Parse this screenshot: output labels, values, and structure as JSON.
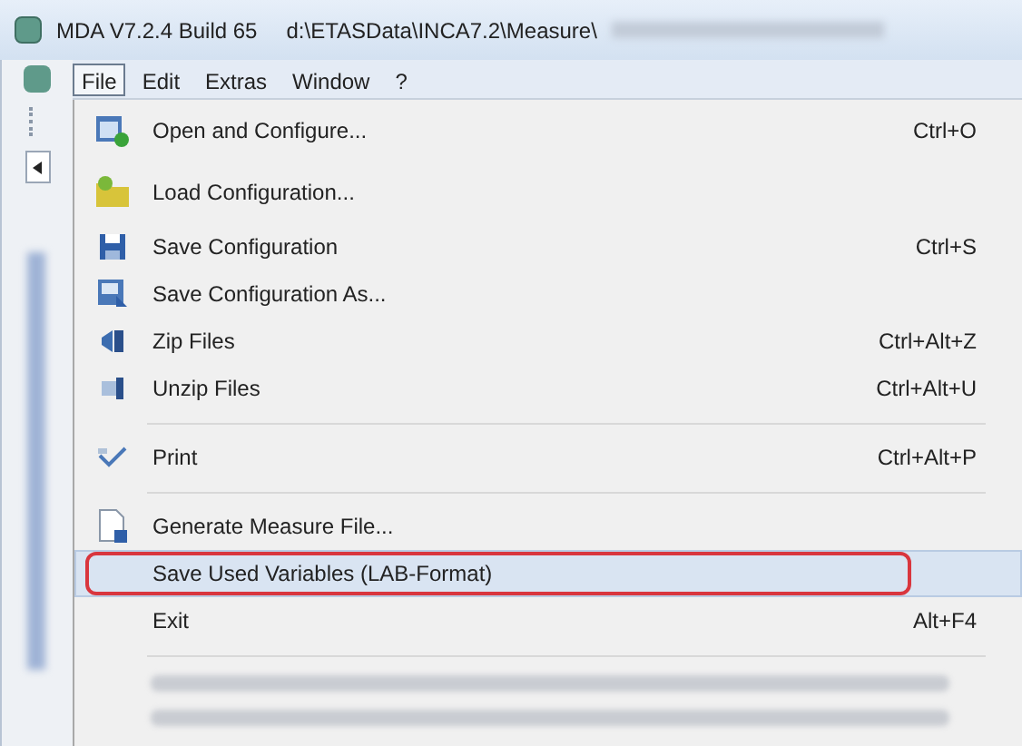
{
  "window": {
    "title": "MDA V7.2.4 Build 65",
    "path": "d:\\ETASData\\INCA7.2\\Measure\\"
  },
  "menubar": [
    {
      "label": "File",
      "selected": true
    },
    {
      "label": "Edit",
      "selected": false
    },
    {
      "label": "Extras",
      "selected": false
    },
    {
      "label": "Window",
      "selected": false
    },
    {
      "label": "?",
      "selected": false
    }
  ],
  "menu": [
    {
      "kind": "item",
      "label": "Open and Configure...",
      "shortcut": "Ctrl+O",
      "selected": false,
      "annotated": false
    },
    {
      "kind": "item",
      "label": "Load Configuration...",
      "selected": false,
      "annotated": false
    },
    {
      "kind": "item",
      "label": "Save Configuration",
      "shortcut": "Ctrl+S",
      "selected": false,
      "annotated": false
    },
    {
      "kind": "item",
      "label": "Save Configuration As...",
      "selected": false,
      "annotated": false
    },
    {
      "kind": "item",
      "label": "Zip Files",
      "shortcut": "Ctrl+Alt+Z",
      "selected": false,
      "annotated": false
    },
    {
      "kind": "item",
      "label": "Unzip Files",
      "shortcut": "Ctrl+Alt+U",
      "selected": false,
      "annotated": false
    },
    {
      "kind": "separator"
    },
    {
      "kind": "item",
      "label": "Print",
      "shortcut": "Ctrl+Alt+P",
      "selected": false,
      "annotated": false
    },
    {
      "kind": "separator"
    },
    {
      "kind": "item",
      "label": "Generate Measure File...",
      "selected": false,
      "annotated": false
    },
    {
      "kind": "item",
      "label": "Save Used Variables (LAB-Format)",
      "selected": true,
      "annotated": true
    },
    {
      "kind": "item",
      "label": "Exit",
      "shortcut": "Alt+F4",
      "selected": false,
      "annotated": false
    },
    {
      "kind": "separator"
    },
    {
      "kind": "recent"
    },
    {
      "kind": "recent"
    }
  ]
}
